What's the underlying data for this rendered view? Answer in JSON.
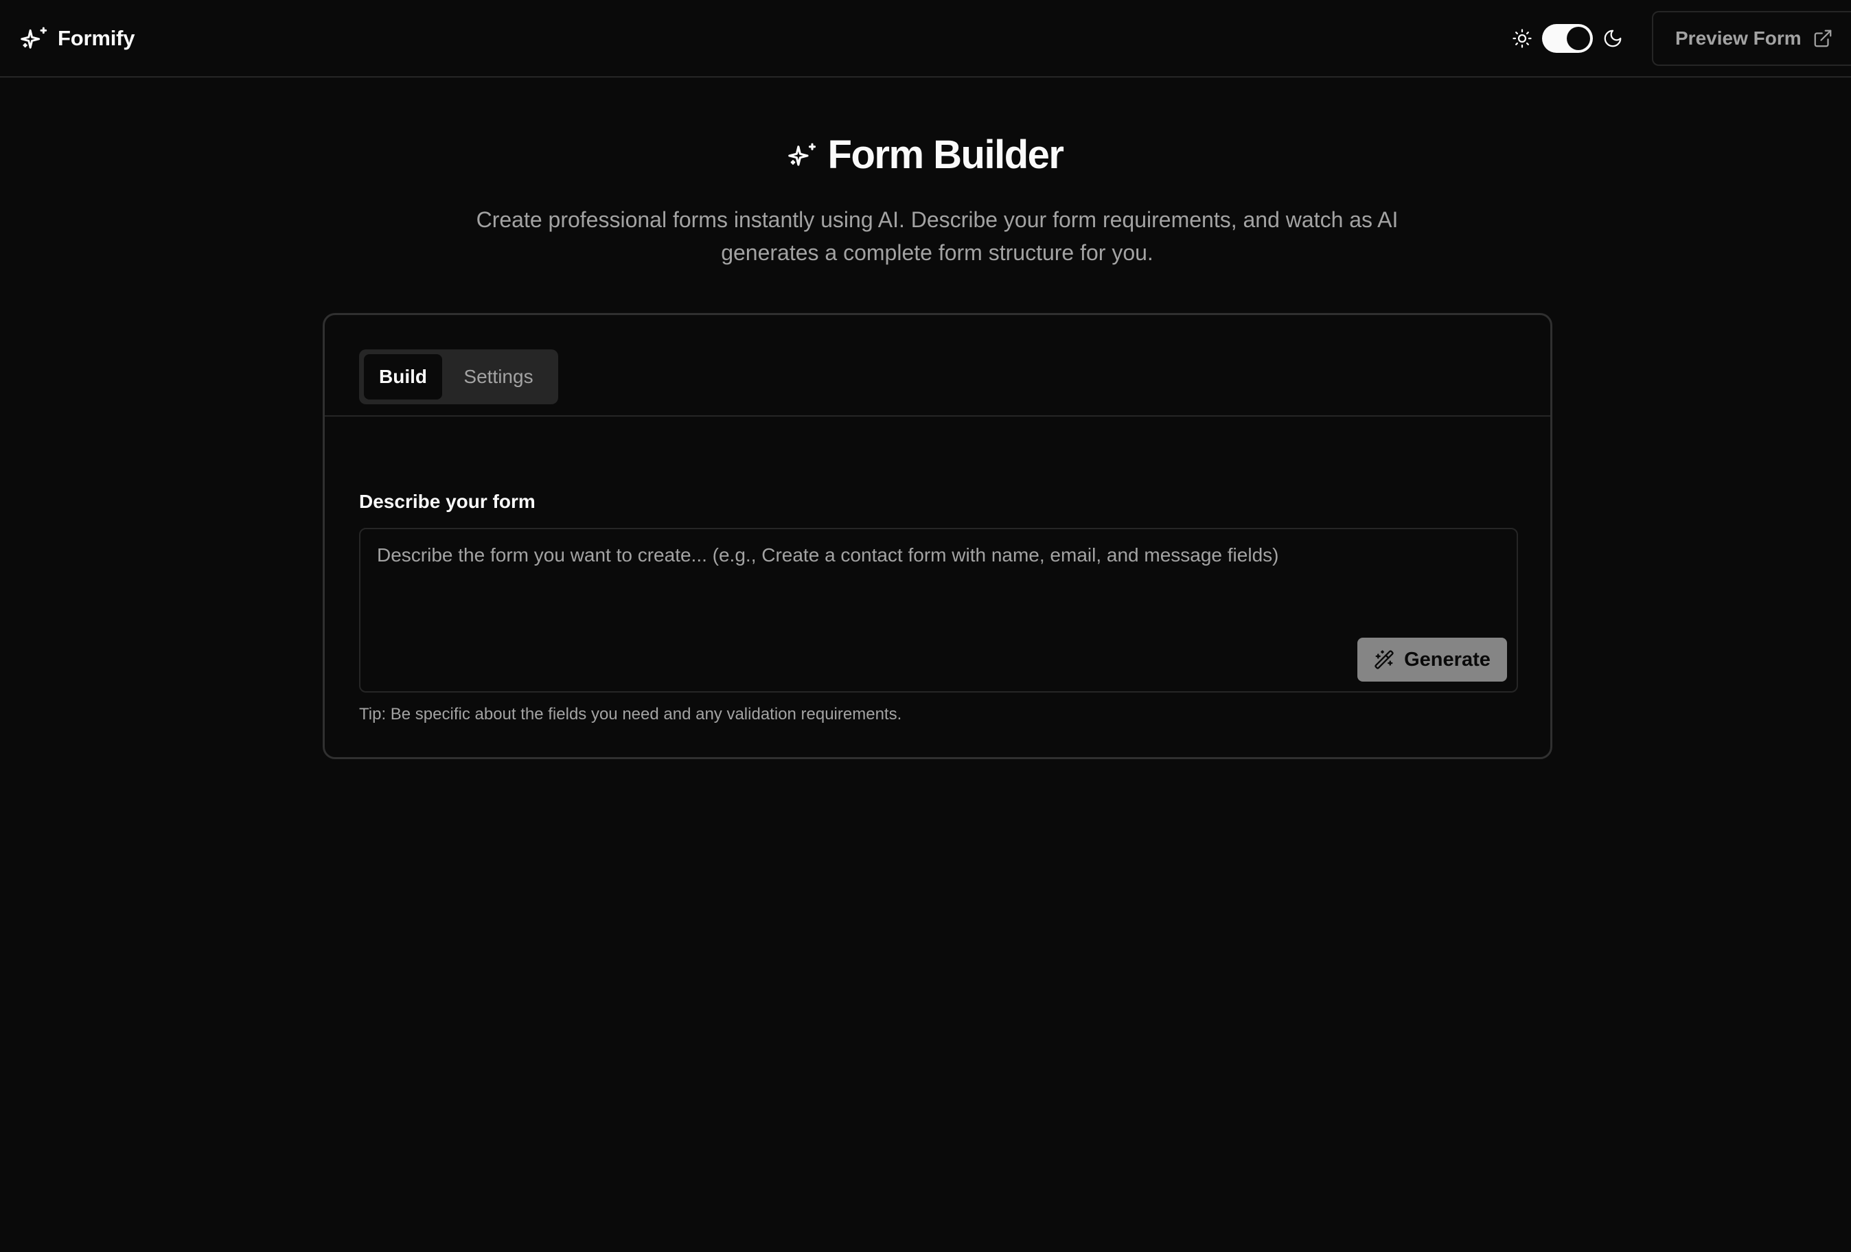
{
  "header": {
    "brand_name": "Formify",
    "brand_icon": "sparkles-icon",
    "theme": {
      "light_icon": "sun-icon",
      "dark_icon": "moon-icon",
      "mode": "dark"
    },
    "preview_label": "Preview Form",
    "preview_icon": "external-link-icon"
  },
  "hero": {
    "icon": "sparkles-icon",
    "title": "Form Builder",
    "description": "Create professional forms instantly using AI. Describe your form requirements, and watch as AI generates a complete form structure for you."
  },
  "builder": {
    "tabs": [
      {
        "label": "Build",
        "active": true
      },
      {
        "label": "Settings",
        "active": false
      }
    ],
    "prompt_label": "Describe your form",
    "prompt_placeholder": "Describe the form you want to create... (e.g., Create a contact form with name, email, and message fields)",
    "prompt_value": "",
    "generate_label": "Generate",
    "generate_icon": "wand-sparkles-icon",
    "tip": "Tip: Be specific about the fields you need and any validation requirements."
  },
  "colors": {
    "background": "#0a0a0a",
    "foreground": "#fafafa",
    "muted": "#a3a3a3",
    "border": "#262626",
    "button_disabled": "#858585"
  }
}
